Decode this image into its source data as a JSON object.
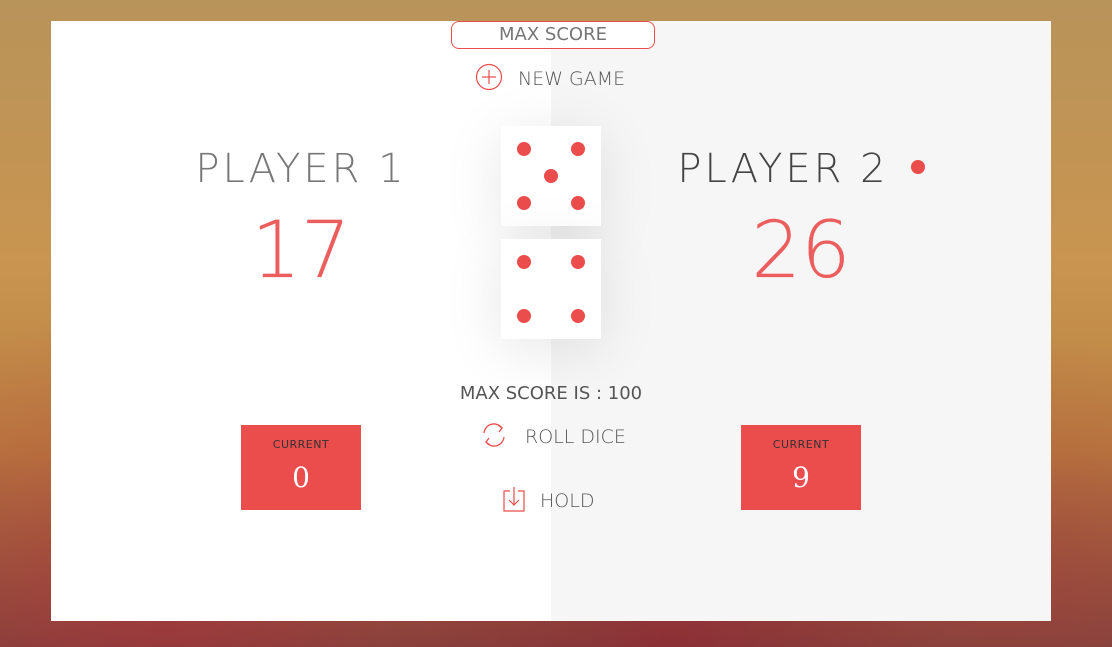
{
  "game": {
    "max_score_placeholder": "MAX SCORE",
    "new_game_label": "NEW GAME",
    "max_score_text": "MAX SCORE IS : 100",
    "roll_label": "ROLL DICE",
    "hold_label": "HOLD",
    "dice": [
      5,
      4
    ]
  },
  "players": [
    {
      "name": "PLAYER 1",
      "score": "17",
      "current_label": "CURRENT",
      "current": "0",
      "active": false
    },
    {
      "name": "PLAYER 2",
      "score": "26",
      "current_label": "CURRENT",
      "current": "9",
      "active": true
    }
  ],
  "colors": {
    "accent": "#eb4d4d",
    "panel_light": "#ffffff",
    "panel_gray": "#f6f6f6"
  }
}
